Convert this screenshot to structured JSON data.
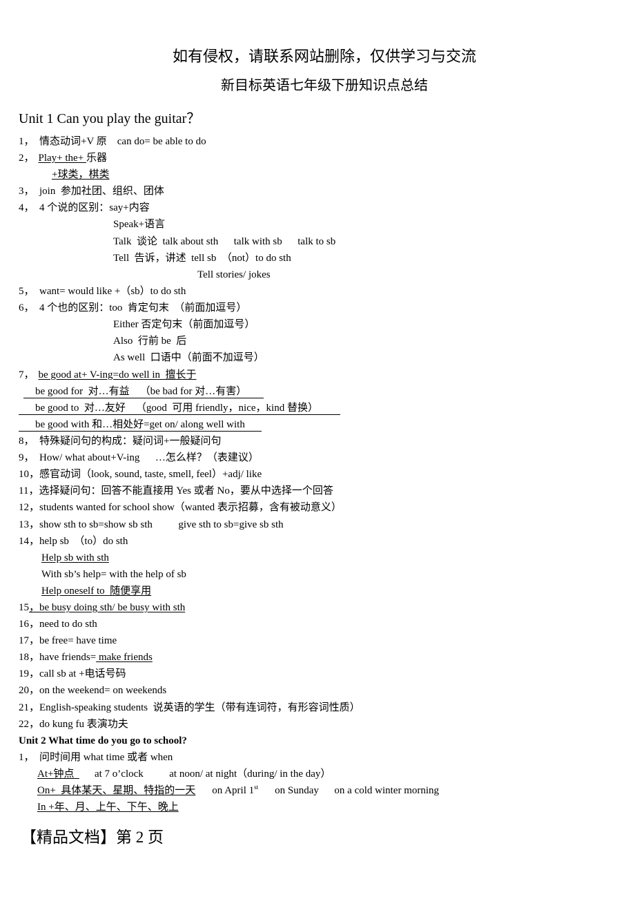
{
  "watermark": "如有侵权，请联系网站删除，仅供学习与交流",
  "doc_title": "新目标英语七年级下册知识点总结",
  "unit1": {
    "title": "Unit 1 Can you play the guitar？",
    "lines": [
      "1，  情态动词+V 原    can do= be able to do",
      "2，",
      "Play+ the+ ",
      "乐器",
      "+球类，棋类",
      "3，  join  参加社团、组织、团体",
      "4，  4 个说的区别：say+内容",
      "Speak+语言",
      "Talk  谈论  talk about sth      talk with sb      talk to sb",
      "Tell  告诉，讲述  tell sb  （not）to do sth",
      "Tell stories/ jokes",
      "5，  want= would like +（sb）to do sth",
      "6，  4 个也的区别：too  肯定句末  （前面加逗号）",
      "Either 否定句末（前面加逗号）",
      "Also  行前 be  后",
      "As well  口语中（前面不加逗号）",
      "7，",
      "be good at+ V-ing=do well in  擅长于",
      "be good for  对…有益    （be bad for 对…有害）",
      "be good to  对…友好    （good  可用 friendly，nice，kind 替换）",
      "be good with 和…相处好=get on/ along well with",
      "8，  特殊疑问句的构成：疑问词+一般疑问句",
      "9，  How/ what about+V-ing      …怎么样？（表建议）",
      "10，感官动词（look, sound, taste, smell, feel）+adj/ like",
      "11，选择疑问句：回答不能直接用 Yes 或者 No，要从中选择一个回答",
      "12，students wanted for school show（wanted 表示招募，含有被动意义）",
      "13，show sth to sb=show sb sth          give sth to sb=give sb sth",
      "14，help sb  （to）do sth",
      "Help sb with sth",
      "With sb’s help= with the help of sb",
      "Help oneself to  随便享用",
      "15",
      "，be busy doing sth/ be busy with sth",
      "16，need to do sth",
      "17，be free= have time",
      "18，have friends=",
      " make friends",
      "19，call sb at +电话号码",
      "20，on the weekend= on weekends",
      "21，English-speaking students  说英语的学生（带有连词符，有形容词性质）",
      "22，do kung fu 表演功夫"
    ]
  },
  "unit2": {
    "title": "Unit 2 What time do you go to school?",
    "lines": [
      "1，  问时间用 what time 或者 when",
      "At+钟点  ",
      "at 7 o’clock          at noon/ at night（during/ in the day）",
      "On+  具体某天、星期、特指的一天",
      "on April 1",
      "st",
      "on Sunday      on a cold winter morning",
      "In +年、月、上午、下午、晚上"
    ]
  },
  "footer": "【精品文档】第 2 页"
}
